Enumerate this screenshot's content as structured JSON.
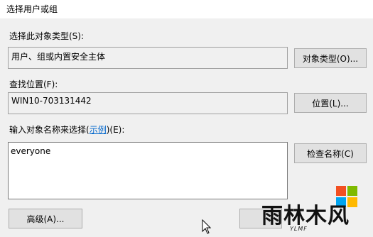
{
  "window": {
    "title": "选择用户或组"
  },
  "object_type": {
    "label": "选择此对象类型(S):",
    "value": "用户、组或内置安全主体",
    "button": "对象类型(O)..."
  },
  "location": {
    "label": "查找位置(F):",
    "value": "WIN10-703131442",
    "button": "位置(L)..."
  },
  "names": {
    "label_prefix": "输入对象名称来选择(",
    "label_link": "示例",
    "label_suffix": ")(E):",
    "value": "everyone",
    "button": "检查名称(C)"
  },
  "footer": {
    "advanced_button": "高级(A)..."
  },
  "watermark": {
    "text": "雨林木风",
    "sub": "YLMF",
    "colors": [
      "#f25022",
      "#7fba00",
      "#00a4ef",
      "#ffb900"
    ]
  }
}
